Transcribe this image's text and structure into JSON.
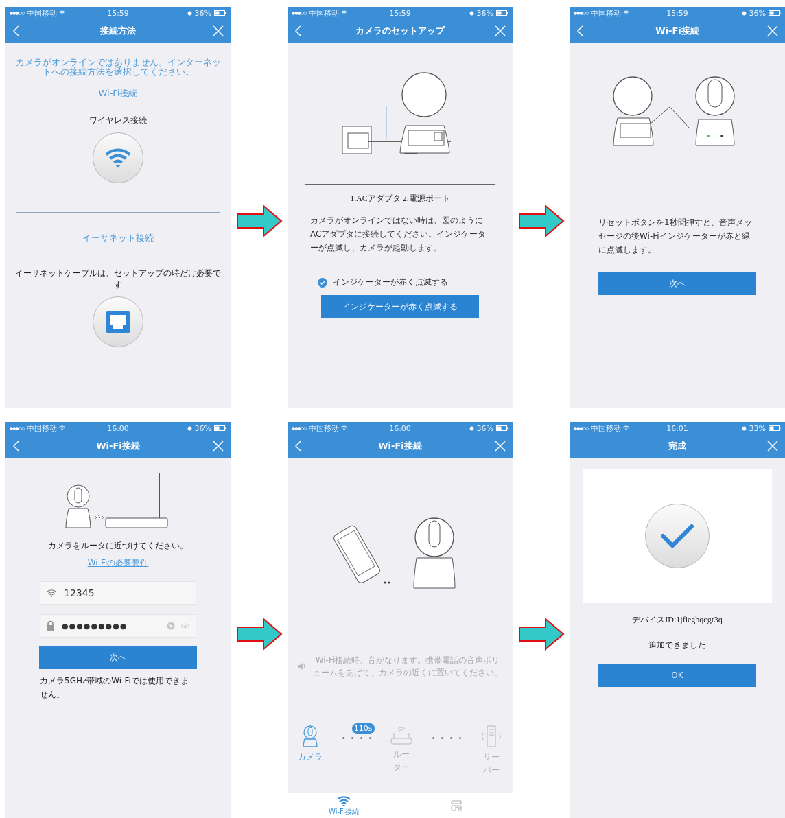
{
  "screens": [
    {
      "kind": "methods",
      "status": {
        "carrier": "中国移动",
        "time": "15:59",
        "battery": "36%"
      },
      "header": {
        "title": "接続方法",
        "back": true
      },
      "intro": "カメラがオンラインではありません。インターネットへの接続方法を選択してください。",
      "options": [
        {
          "kind": "wifi",
          "title": "Wi-Fi接続",
          "label": "ワイヤレス接続"
        },
        {
          "kind": "ethernet",
          "title": "イーサネット接続",
          "label": "イーサネットケーブルは、セットアップの時だけ必要です"
        }
      ]
    },
    {
      "kind": "setup",
      "status": {
        "carrier": "中国移动",
        "time": "15:59",
        "battery": "36%"
      },
      "header": {
        "title": "カメラのセットアップ",
        "back": true
      },
      "caption": "1.ACアダプタ 2.電源ポート",
      "description": "カメラがオンラインではない時は、図のようにACアダプタに接続してください。インジケーターが点滅し、カメラが起動します。",
      "checkbox": {
        "label": "インジケーターが赤く点滅する",
        "checked": true
      },
      "button": "インジケーターが赤く点滅する"
    },
    {
      "kind": "reset",
      "status": {
        "carrier": "中国移动",
        "time": "15:59",
        "battery": "36%"
      },
      "header": {
        "title": "Wi-Fi接続",
        "back": true
      },
      "description": "リセットボタンを1秒間押すと、音声メッセージの後Wi-Fiインジケーターが赤と緑に点滅します。",
      "button": "次へ"
    },
    {
      "kind": "wifi_form",
      "status": {
        "carrier": "中国移动",
        "time": "16:00",
        "battery": "36%"
      },
      "header": {
        "title": "Wi-Fi接続",
        "back": true
      },
      "hint": "カメラをルータに近づけてください。",
      "link": "Wi-Fiの必要要件",
      "ssid": "12345",
      "password": "●●●●●●●●●",
      "button": "次へ",
      "note": "カメラ5GHz帯域のWi-Fiでは使用できません。"
    },
    {
      "kind": "connecting",
      "status": {
        "carrier": "中国移动",
        "time": "16:00",
        "battery": "36%"
      },
      "header": {
        "title": "Wi-Fi接続",
        "back": true
      },
      "notice": "Wi-Fi接続時、音がなります。携帯電話の音声ボリュームをあげて、カメラの近くに置いてください。",
      "timer": "110s",
      "steps": [
        {
          "kind": "camera",
          "label": "カメラ",
          "active": true
        },
        {
          "kind": "router",
          "label": "ルーター",
          "active": false
        },
        {
          "kind": "server",
          "label": "サーバー",
          "active": false
        }
      ],
      "tabs": [
        {
          "kind": "wifi",
          "label": "Wi-Fi接続",
          "selected": true
        },
        {
          "kind": "qr",
          "selected": false
        }
      ]
    },
    {
      "kind": "done",
      "status": {
        "carrier": "中国移动",
        "time": "16:01",
        "battery": "33%"
      },
      "header": {
        "title": "完成",
        "back": false
      },
      "device_id": "デバイスID:1jfiegbqcgr3q",
      "message": "追加できました",
      "button": "OK"
    }
  ]
}
